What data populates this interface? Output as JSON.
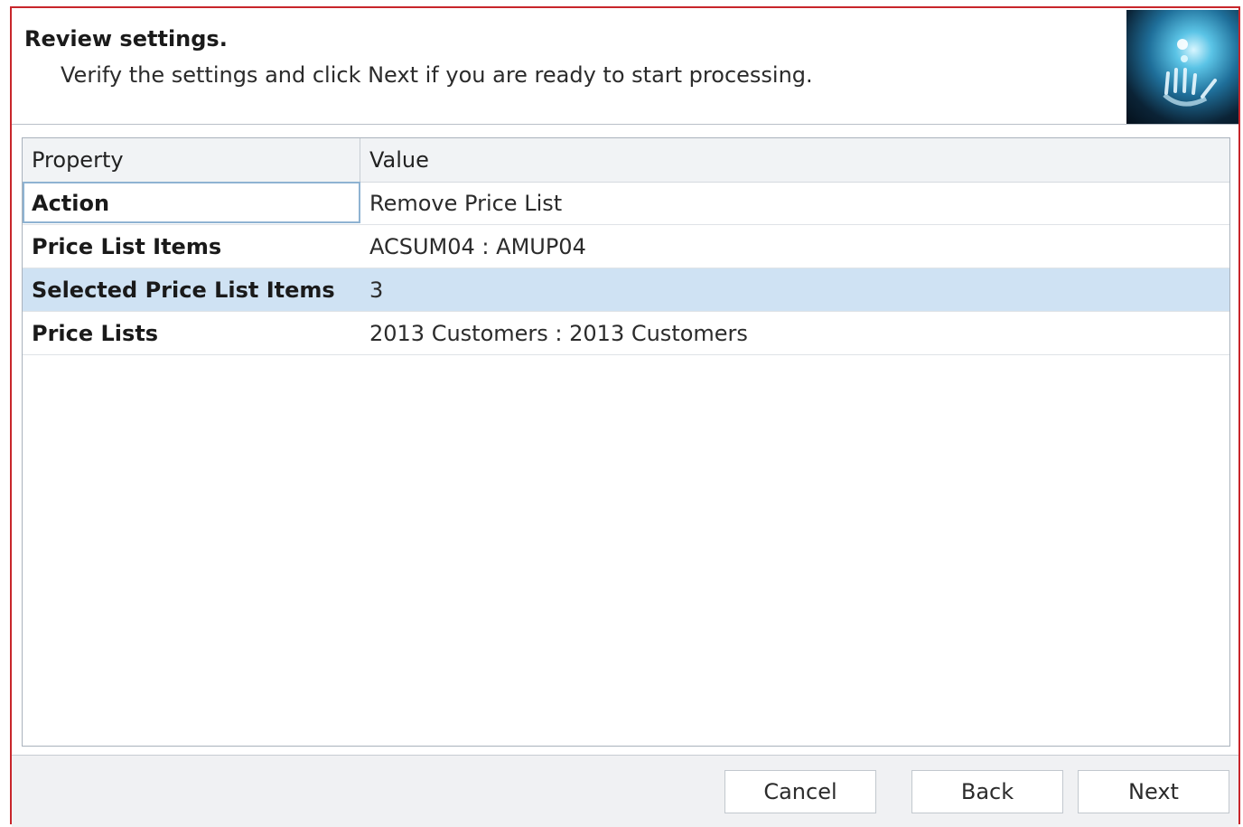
{
  "header": {
    "title": "Review settings.",
    "subtitle": "Verify the settings and click Next if you are ready to start processing.",
    "image_icon": "hand-light-icon"
  },
  "grid": {
    "columns": [
      "Property",
      "Value"
    ],
    "rows": [
      {
        "property": "Action",
        "value": "Remove Price List"
      },
      {
        "property": "Price List Items",
        "value": "ACSUM04  :  AMUP04"
      },
      {
        "property": "Selected Price List Items",
        "value": "3"
      },
      {
        "property": "Price Lists",
        "value": "2013 Customers  :  2013 Customers"
      }
    ],
    "selected_row": 2
  },
  "footer": {
    "cancel": "Cancel",
    "back": "Back",
    "next": "Next"
  },
  "colors": {
    "window_border": "#c8262b",
    "selected_row": "#cfe2f3",
    "focus_border": "#8fb3d2"
  }
}
